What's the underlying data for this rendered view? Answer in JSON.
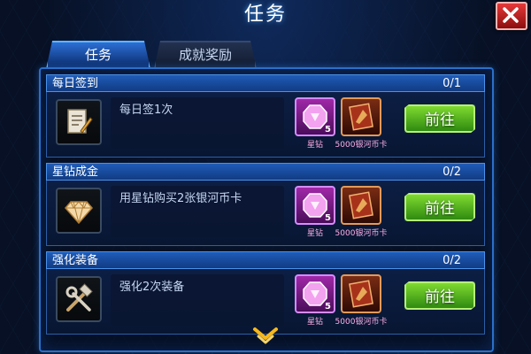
{
  "window": {
    "title": "任务"
  },
  "tabs": [
    {
      "label": "任务",
      "active": true
    },
    {
      "label": "成就奖励",
      "active": false
    }
  ],
  "colors": {
    "accent": "#2b6fc9",
    "go_button": "#4fb31e",
    "gem": "#e04bd8",
    "close": "#d42a2a"
  },
  "tasks": [
    {
      "title": "每日签到",
      "progress": "0/1",
      "description": "每日签1次",
      "icon": "document-pen-icon",
      "rewards": [
        {
          "icon": "pink-gem-icon",
          "count": "5",
          "label": "星钻"
        },
        {
          "icon": "silver-river-card-icon",
          "count": "",
          "label": "5000银河币卡"
        }
      ],
      "button": "前往"
    },
    {
      "title": "星钻成金",
      "progress": "0/2",
      "description": "用星钻购买2张银河币卡",
      "icon": "diamond-icon",
      "rewards": [
        {
          "icon": "pink-gem-icon",
          "count": "5",
          "label": "星钻"
        },
        {
          "icon": "silver-river-card-icon",
          "count": "",
          "label": "5000银河币卡"
        }
      ],
      "button": "前往"
    },
    {
      "title": "强化装备",
      "progress": "0/2",
      "description": "强化2次装备",
      "icon": "hammer-wrench-icon",
      "rewards": [
        {
          "icon": "pink-gem-icon",
          "count": "5",
          "label": "星钻"
        },
        {
          "icon": "silver-river-card-icon",
          "count": "",
          "label": "5000银河币卡"
        }
      ],
      "button": "前往"
    }
  ]
}
